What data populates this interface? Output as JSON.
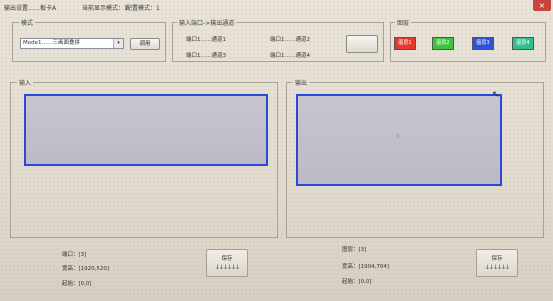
{
  "titlebar": {
    "output_settings": "输出设置……板卡A",
    "display_mode": "当前显示模式：1",
    "config_mode": "配置模式：1",
    "close": "×"
  },
  "mode": {
    "legend": "模式",
    "selected": "Mode1……三画面叠拼",
    "arrow": "▾",
    "apply": "调用"
  },
  "mapping": {
    "legend": "输入端口->输出通道",
    "ch1": "端口1……通道1",
    "ch2": "端口1……通道2",
    "ch3": "端口1……通道3",
    "ch4": "端口1……通道4"
  },
  "layers": {
    "legend": "图层",
    "items": [
      {
        "label": "图层1",
        "color": "#e23a2e"
      },
      {
        "label": "图层2",
        "color": "#3cc43c"
      },
      {
        "label": "图层3",
        "color": "#2f52d8"
      },
      {
        "label": "图层4",
        "color": "#2fbf8e"
      }
    ]
  },
  "input": {
    "legend": "输入",
    "port": "端口：[3]",
    "resolution": "宽高：[1920,520]",
    "origin": "起始：[0,0]",
    "save": "保存",
    "arrows": "↓↓↓↓↓↓"
  },
  "output": {
    "legend": "输出",
    "layer": "图层：[3]",
    "resolution": "宽高：[1904,704]",
    "origin": "起始：[0,0]",
    "center": "3",
    "save": "保存",
    "arrows": "↓↓↓↓↓↓"
  },
  "colors": {
    "selection_border": "#2a49d8"
  }
}
